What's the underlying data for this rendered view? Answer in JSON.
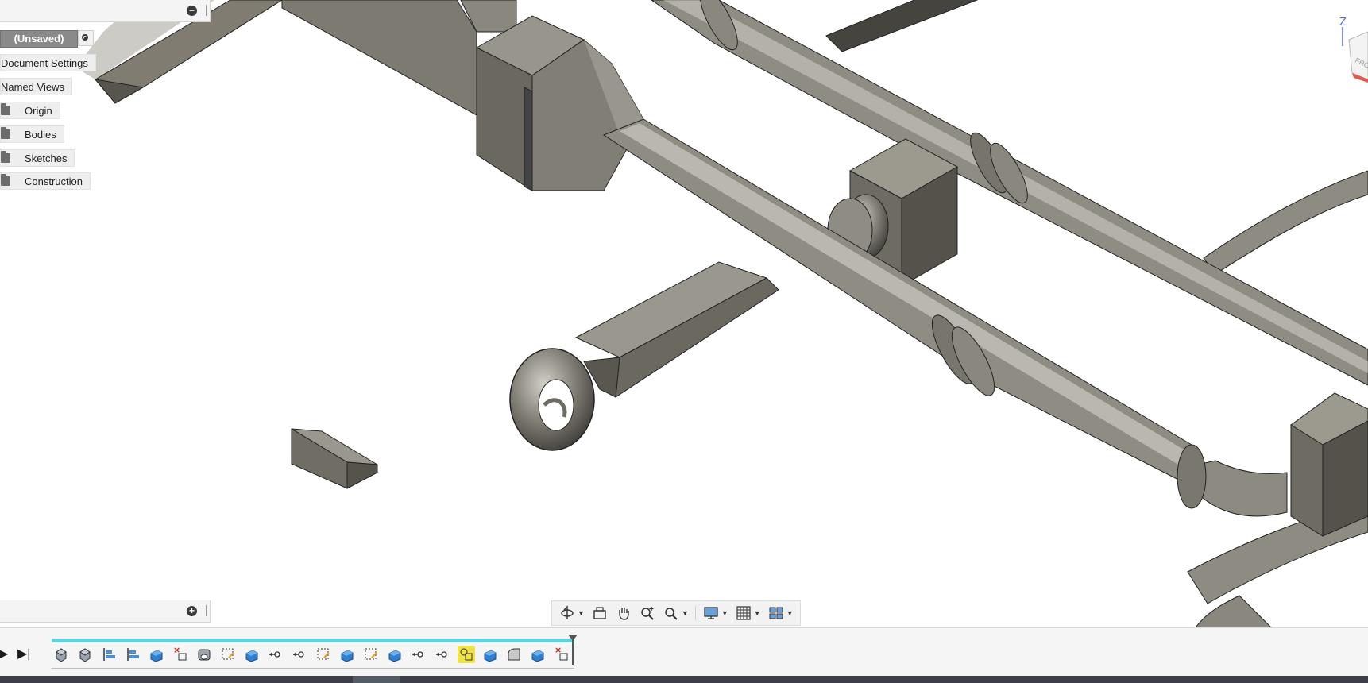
{
  "browser": {
    "document_status": "(Unsaved)",
    "items": [
      {
        "label": "Document Settings",
        "kind": "settings"
      },
      {
        "label": "Named Views",
        "kind": "views"
      },
      {
        "label": "Origin",
        "kind": "folder"
      },
      {
        "label": "Bodies",
        "kind": "folder"
      },
      {
        "label": "Sketches",
        "kind": "folder"
      },
      {
        "label": "Construction",
        "kind": "folder"
      }
    ],
    "collapse_icon": "minus-circle-icon",
    "expand_icon": "plus-circle-icon"
  },
  "viewcube": {
    "axis_label": "Z",
    "face_label": "FRONT"
  },
  "nav_toolbar": {
    "tools": [
      "orbit-icon",
      "look-at-icon",
      "pan-icon",
      "zoom-icon",
      "zoom-window-icon",
      "display-settings-icon",
      "grid-icon",
      "viewports-icon"
    ]
  },
  "timeline": {
    "controls": [
      "play-icon",
      "go-to-end-icon"
    ],
    "active_feature_index": 17,
    "feature_icons": [
      "extrude-icon",
      "extrude-icon",
      "sketch-align-icon",
      "sketch-align-icon",
      "body-icon",
      "delete-body-icon",
      "revolve-icon",
      "sketch-icon",
      "body-icon",
      "joint-icon",
      "joint-icon",
      "sketch-icon",
      "body-icon",
      "sketch-icon",
      "body-icon",
      "joint-icon",
      "joint-icon",
      "combine-icon",
      "body-icon",
      "fillet-icon",
      "body-icon",
      "delete-body-icon"
    ]
  },
  "colors": {
    "accent": "#5bd4e0",
    "highlight": "#f0e34a",
    "panel": "#eeeeee",
    "metal": "#6e6b63"
  }
}
